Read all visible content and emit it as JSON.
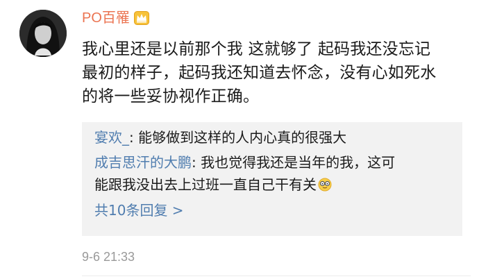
{
  "comment": {
    "username": "PO百罹",
    "username_color": "#eb7350",
    "badge_icon": "crown-icon",
    "lines": [
      "我心里还是以前那个我 这就够了 起码我还没忘记",
      "最初的样子，起码我还知道去怀念，没有心如死水",
      "的将一些妥协视作正确。"
    ],
    "timestamp": "9-6 21:33"
  },
  "replies": {
    "items": [
      {
        "name": "宴欢_",
        "separator": ": ",
        "text_lines": [
          "能够做到这样的人内心真的很强大"
        ]
      },
      {
        "name": "成吉思汗的大鹏",
        "separator": ": ",
        "text_lines": [
          "我也觉得我还是当年的我，这可",
          "能跟我没出去上过班一直自己干有关"
        ],
        "trailing_emoji": "eyeglasses-face-emoji-icon"
      }
    ],
    "more_label": "共10条回复 >",
    "link_color": "#507daf"
  }
}
